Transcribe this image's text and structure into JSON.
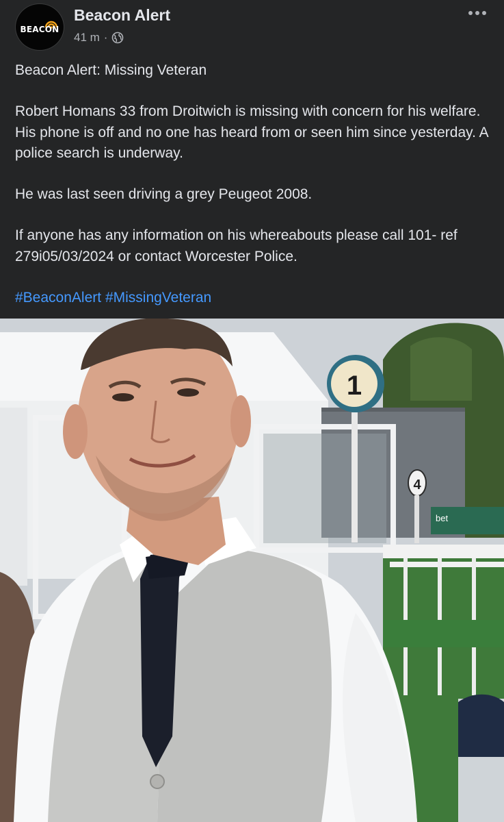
{
  "post": {
    "page_name": "Beacon Alert",
    "avatar_text": "BEACON",
    "time": "41 m",
    "separator": "·",
    "privacy_icon": "globe-icon",
    "more_icon": "more-horizontal-icon",
    "title": "Beacon Alert: Missing Veteran",
    "body_1": "Robert Homans 33 from Droitwich is missing with concern for his welfare. His phone is off and no one has heard from or seen him since yesterday. A police search is underway.",
    "body_2": "He was last seen driving a grey Peugeot 2008.",
    "body_3": "If anyone has any information on his whereabouts please call 101- ref 279i05/03/2024 or contact Worcester Police.",
    "hashtags": [
      "#BeaconAlert",
      "#MissingVeteran"
    ]
  },
  "photo": {
    "sign_number_large": "1",
    "sign_number_small": "4",
    "banner_text": "bet"
  },
  "colors": {
    "background": "#242526",
    "text": "#e4e6eb",
    "muted": "#b0b3b8",
    "link": "#4599ff"
  }
}
